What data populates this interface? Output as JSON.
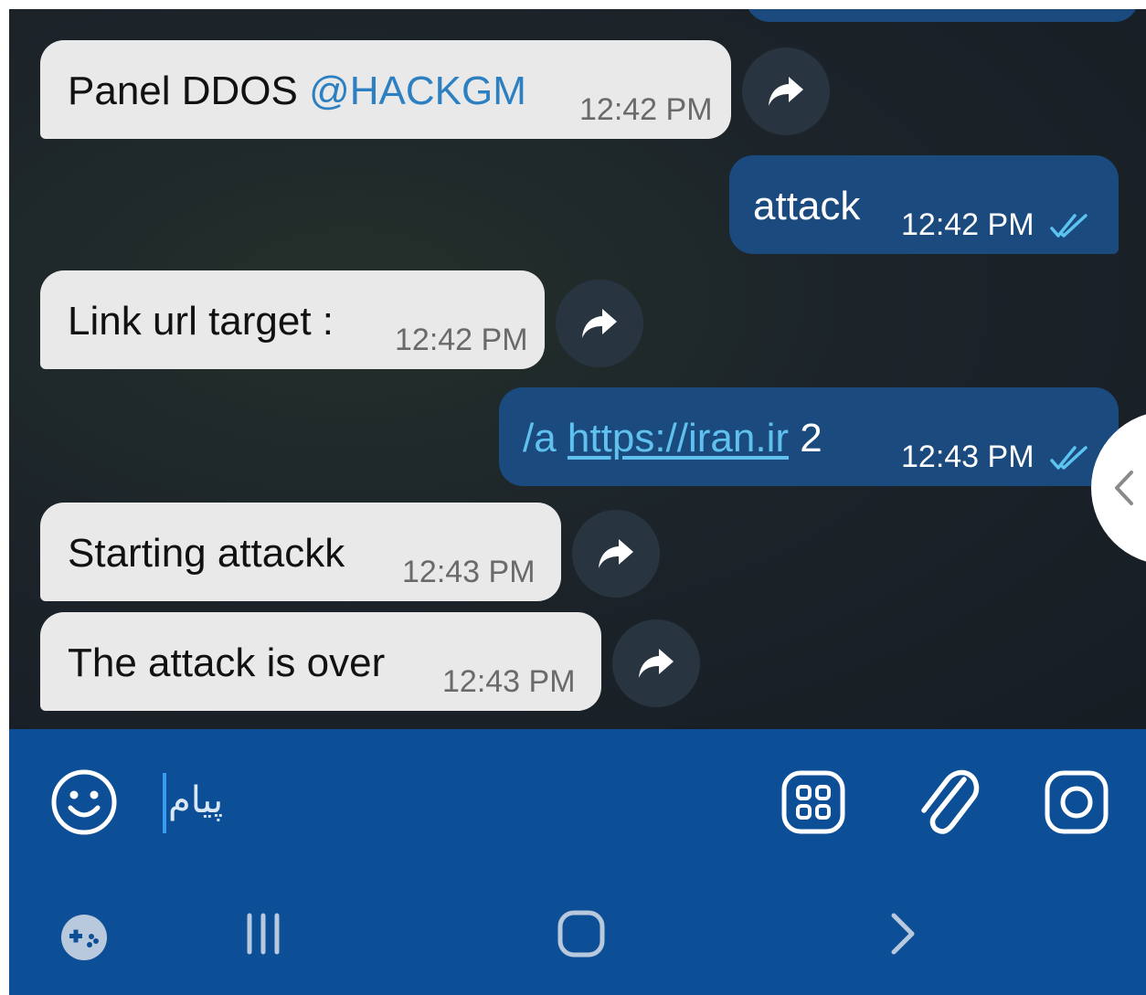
{
  "messages": [
    {
      "dir": "in",
      "text": "Panel DDOS ",
      "mention": "@HACKGM",
      "time": "12:42 PM"
    },
    {
      "dir": "out",
      "text": "attack",
      "time": "12:42 PM",
      "status": "read"
    },
    {
      "dir": "in",
      "text": "Link url target :",
      "time": "12:42 PM"
    },
    {
      "dir": "out",
      "command": "/a ",
      "link": "https://iran.ir",
      "suffix": " 2",
      "time": "12:43 PM",
      "status": "read"
    },
    {
      "dir": "in",
      "text": "Starting attackk",
      "time": "12:43 PM"
    },
    {
      "dir": "in",
      "text": "The attack is over",
      "time": "12:43 PM"
    }
  ],
  "composer": {
    "placeholder": "پیام",
    "icons": [
      "emoji-icon",
      "sticker-panel-icon",
      "attach-icon",
      "camera-icon"
    ]
  },
  "navbar": {
    "icons": [
      "game-launcher-icon",
      "recent-apps-icon",
      "home-icon",
      "back-icon"
    ]
  },
  "colors": {
    "chat_background": "#1c242a",
    "incoming_bubble": "#e9e9e9",
    "outgoing_bubble": "#1a4a7e",
    "composer_bar": "#0d4f97",
    "link": "#60c1ee",
    "mention": "#2c7fc0",
    "read_ticks": "#5cc3f0"
  }
}
